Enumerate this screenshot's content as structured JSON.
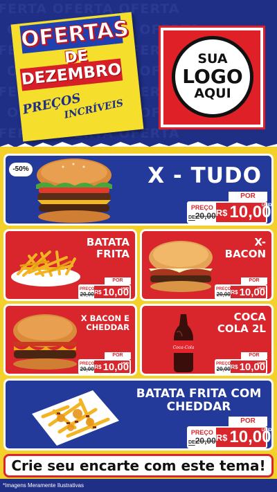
{
  "header": {
    "bg_word": "OFERTA OFERTA OFERTA",
    "title_line1": "OFERTAS",
    "title_line2": "DE",
    "title_line3": "DEZEMBRO",
    "subtitle_line1": "PREÇOS",
    "subtitle_line2": "INCRÍVEIS",
    "logo_line1": "SUA",
    "logo_line2": "LOGO",
    "logo_line3": "AQUI"
  },
  "common": {
    "por": "POR",
    "preco": "PREÇO",
    "de_prefix": "DE",
    "old_price": "20,00",
    "currency": "R$",
    "unid": "UNID",
    "new_price": "10,00"
  },
  "products": {
    "xtudo": {
      "title": "X - TUDO",
      "badge": "-50%"
    },
    "batata": {
      "title_l1": "BATATA",
      "title_l2": "FRITA"
    },
    "xbacon": {
      "title_l1": "X-",
      "title_l2": "BACON"
    },
    "xcheddar": {
      "title_l1": "X BACON E",
      "title_l2": "CHEDDAR"
    },
    "coca": {
      "title_l1": "COCA",
      "title_l2": "COLA 2L",
      "brand": "Coca-Cola"
    },
    "cheddar": {
      "title_l1": "BATATA FRITA COM",
      "title_l2": "CHEDDAR"
    }
  },
  "cta": "Crie seu encarte com este tema!",
  "footer": "*Imagens Meramente Ilustrativas",
  "colors": {
    "blue": "#243a9a",
    "red": "#d8262c",
    "yellow": "#f4d02a",
    "navy": "#1f2f86"
  }
}
